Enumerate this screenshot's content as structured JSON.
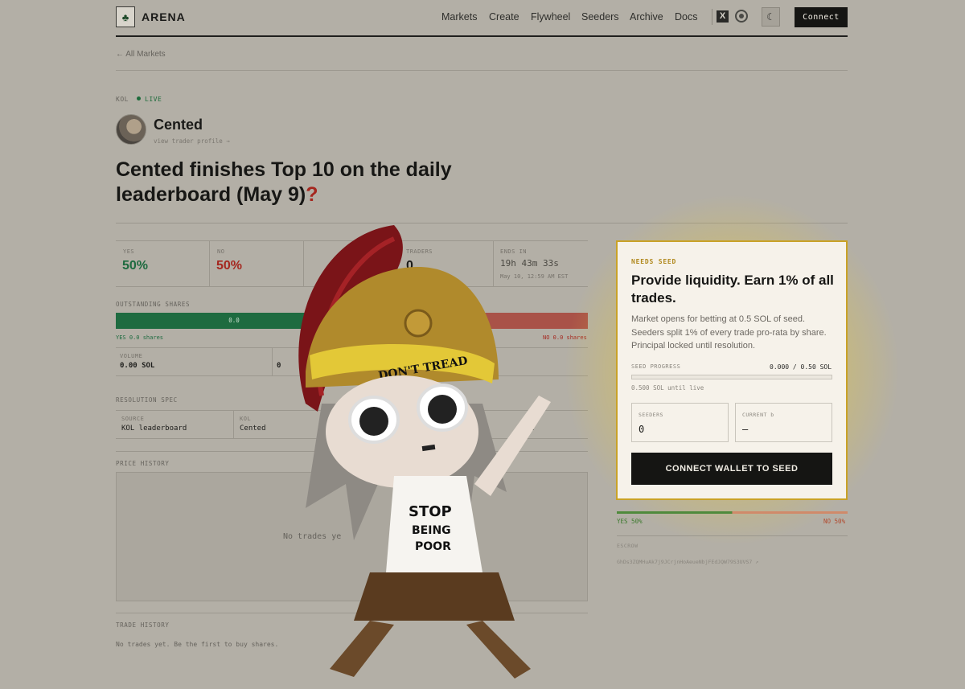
{
  "header": {
    "brand": "ARENA",
    "logo_icon": "tree-logo-icon",
    "nav": [
      "Markets",
      "Create",
      "Flywheel",
      "Seeders",
      "Archive",
      "Docs"
    ],
    "connect_label": "Connect"
  },
  "back_link": "← All Markets",
  "market": {
    "category": "KOL",
    "status": "LIVE",
    "kol_name": "Cented",
    "profile_link": "view trader profile →",
    "title": "Cented finishes Top 10 on the daily leaderboard (May 9)",
    "title_mark": "?"
  },
  "stats": {
    "yes_label": "YES",
    "yes_value": "50%",
    "no_label": "NO",
    "no_value": "50%",
    "traders_label": "TRADERS",
    "traders_value": "0",
    "ends_label": "ENDS IN",
    "ends_value": "19h 43m 33s",
    "ends_date": "May 10, 12:59 AM EST"
  },
  "shares": {
    "label": "OUTSTANDING SHARES",
    "yes_bar": "0.0",
    "no_bar": "0.0",
    "yes_caption": "YES 0.0 shares",
    "no_caption": "NO 0.0 shares",
    "volume_label": "VOLUME",
    "volume_value": "0.00 SOL",
    "yes_fraction": 0.5
  },
  "resolution": {
    "label": "RESOLUTION SPEC",
    "source_label": "SOURCE",
    "source_value": "KOL leaderboard",
    "kol_label": "KOL",
    "kol_value": "Cented",
    "extra_value": "e"
  },
  "price_history": {
    "label": "PRICE HISTORY",
    "empty": "No trades ye"
  },
  "trade_history": {
    "label": "TRADE HISTORY",
    "empty": "No trades yet. Be the first to buy shares."
  },
  "seed_card": {
    "tag": "NEEDS SEED",
    "title": "Provide liquidity. Earn 1% of all trades.",
    "description": "Market opens for betting at 0.5 SOL of seed. Seeders split 1% of every trade pro-rata by share. Principal locked until resolution.",
    "progress_label": "SEED PROGRESS",
    "progress_value": "0.000 / 0.50 SOL",
    "progress_fraction": 0.0,
    "until_live": "0.500 SOL until live",
    "seeders_label": "SEEDERS",
    "seeders_value": "0",
    "current_b_label": "CURRENT b",
    "current_b_value": "—",
    "button": "CONNECT WALLET TO SEED"
  },
  "sidebar": {
    "yes_pct": "YES 50%",
    "no_pct": "NO 50%",
    "escrow_label": "ESCROW",
    "escrow_value": "GhDs3ZQMHuAk7j9JCrjnHoAeueNbjFEdJQW79S3UVS7 ↗"
  },
  "overlay": {
    "helmet_text": "DON'T TREAD",
    "shirt_text": [
      "STOP",
      "BEING",
      "POOR"
    ]
  },
  "colors": {
    "yes": "#1e6b40",
    "no": "#a95248",
    "accent": "#c9a227"
  }
}
